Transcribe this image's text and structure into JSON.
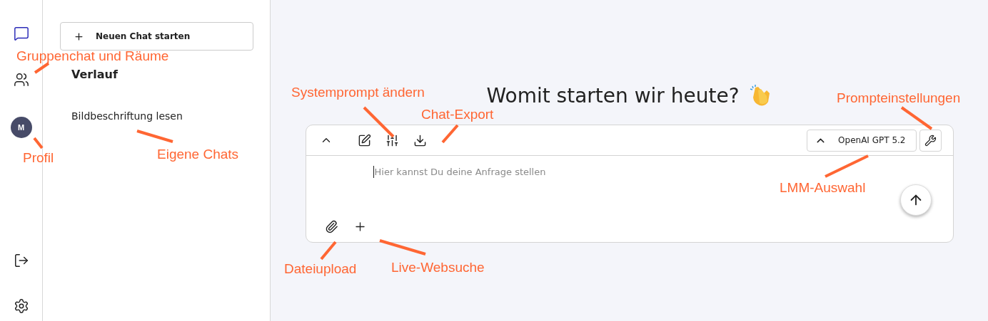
{
  "rail": {
    "top_items": [
      {
        "kind": "chat",
        "selected": true
      },
      {
        "kind": "users",
        "selected": false
      }
    ],
    "avatar": "M",
    "bottom_items": [
      {
        "kind": "logout"
      },
      {
        "kind": "settings"
      }
    ]
  },
  "sidebar": {
    "new_chat_button": "Neuen Chat starten",
    "history_title": "Verlauf",
    "chats": [
      "Bildbeschriftung lesen"
    ]
  },
  "main": {
    "heading": "Womit starten wir heute?",
    "composer": {
      "model": "OpenAI GPT 5.2",
      "placeholder": "Hier kannst Du deine Anfrage stellen"
    }
  },
  "annotations": [
    "Gruppenchat und Räume",
    "Profil",
    "Eigene Chats",
    "Systemprompt ändern",
    "Chat-Export",
    "Prompteinstellungen",
    "LMM-Auswahl",
    "Dateiupload",
    "Live-Websuche"
  ]
}
